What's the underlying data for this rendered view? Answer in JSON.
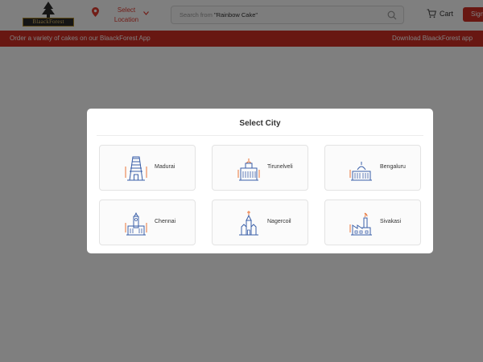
{
  "header": {
    "logo_text": "BlaackForest",
    "location_label": "Select Location",
    "search_placeholder": "Search from ",
    "search_example": "\"Rainbow Cake\"",
    "cart_label": "Cart",
    "signup_label": "Sign"
  },
  "banner": {
    "left_text": "Order a variety of cakes on our BlaackForest App",
    "right_text": "Download BlaackForest app"
  },
  "modal": {
    "title": "Select City",
    "cities": [
      {
        "name": "Madurai",
        "icon": "temple-tower-icon"
      },
      {
        "name": "Tirunelveli",
        "icon": "clock-tower-icon"
      },
      {
        "name": "Bengaluru",
        "icon": "vidhana-soudha-icon"
      },
      {
        "name": "Chennai",
        "icon": "central-station-icon"
      },
      {
        "name": "Nagercoil",
        "icon": "church-icon"
      },
      {
        "name": "Sivakasi",
        "icon": "factory-icon"
      }
    ]
  },
  "colors": {
    "brand_red": "#d12f25",
    "icon_blue": "#3a5fa8",
    "icon_orange": "#e8763a"
  }
}
